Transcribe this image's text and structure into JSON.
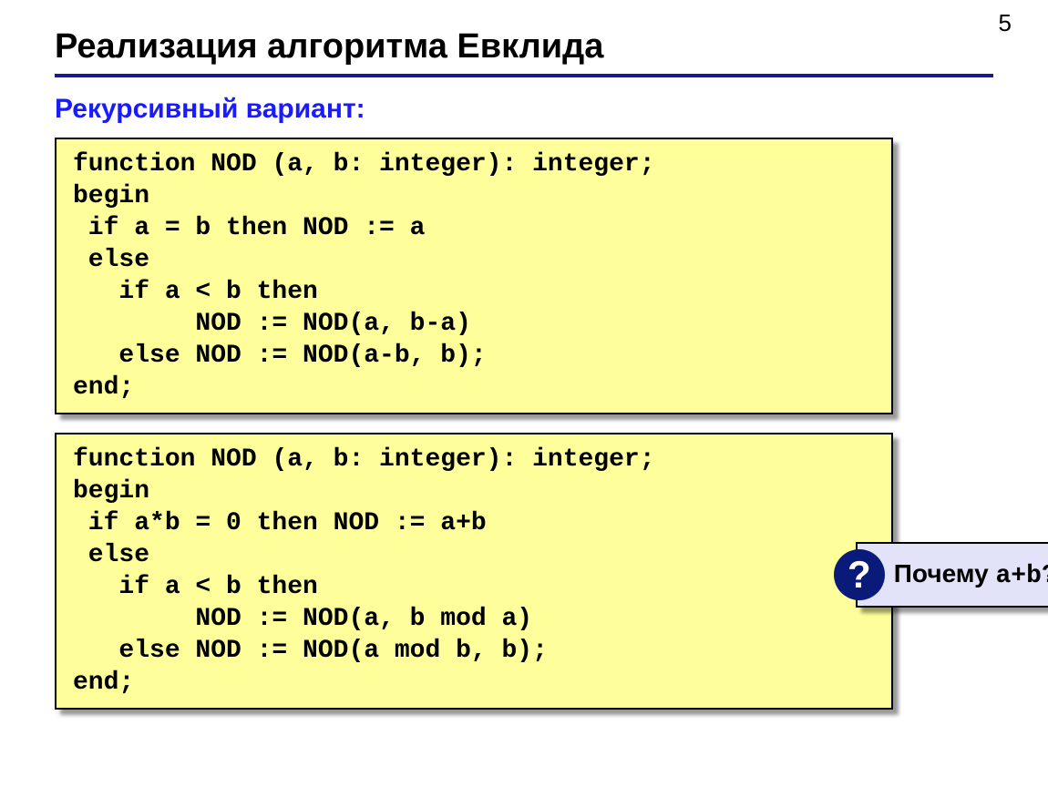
{
  "page_number": "5",
  "title": "Реализация алгоритма Евклида",
  "subtitle": "Рекурсивный вариант:",
  "code_block_1": "function NOD (a, b: integer): integer;\nbegin\n if a = b then NOD := a\n else\n   if a < b then\n        NOD := NOD(a, b-a)\n   else NOD := NOD(a-b, b);\nend;",
  "code_block_2": "function NOD (a, b: integer): integer;\nbegin\n if a*b = 0 then NOD := a+b\n else\n   if a < b then\n        NOD := NOD(a, b mod a)\n   else NOD := NOD(a mod b, b);\nend;",
  "callout": {
    "icon": "?",
    "text_prefix": "Почему ",
    "text_mono": "a+b",
    "text_suffix": "?"
  }
}
